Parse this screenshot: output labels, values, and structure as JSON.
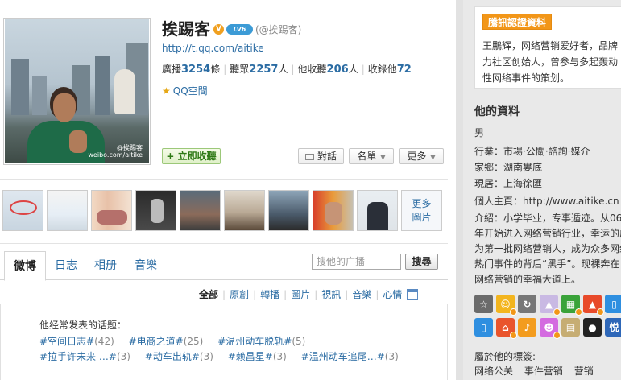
{
  "profile": {
    "name": "挨踢客",
    "vip_label": "LV6",
    "handle": "(@挨踢客)",
    "url": "http://t.qq.com/aitike",
    "avatar_watermark_1": "@挨踢客",
    "avatar_watermark_2": "weibo.com/aitike",
    "qzone": "QQ空間"
  },
  "stats": {
    "broadcast_label": "廣播",
    "broadcast_value": "3254",
    "broadcast_unit": "條",
    "listeners_label": "聽眾",
    "listeners_value": "2257",
    "listeners_unit": "人",
    "listening_label": "他收聽",
    "listening_value": "206",
    "listening_unit": "人",
    "favorites_label": "收錄他",
    "favorites_value": "72"
  },
  "actions": {
    "follow": "+ 立即收聽",
    "chat": "對話",
    "list": "名單",
    "more": "更多"
  },
  "photos": {
    "more_line1": "更多",
    "more_line2": "圖片"
  },
  "tabs": [
    {
      "label": "微博"
    },
    {
      "label": "日志"
    },
    {
      "label": "相册"
    },
    {
      "label": "音樂"
    }
  ],
  "search": {
    "placeholder": "搜他的广播",
    "button": "搜尋"
  },
  "filters": [
    "全部",
    "原創",
    "轉播",
    "圖片",
    "視訊",
    "音樂",
    "心情"
  ],
  "topics": {
    "title": "他经常发表的话题：",
    "row1": [
      {
        "name": "#空间日志#",
        "count": "(42)"
      },
      {
        "name": "#电商之道#",
        "count": "(25)"
      },
      {
        "name": "#温州动车脱轨#",
        "count": "(5)"
      }
    ],
    "row2": [
      {
        "name": "#拉手许未来 …#",
        "count": "(3)"
      },
      {
        "name": "#动车出轨#",
        "count": "(3)"
      },
      {
        "name": "#赖昌星#",
        "count": "(3)"
      },
      {
        "name": "#温州动车追尾…#",
        "count": "(3)"
      }
    ]
  },
  "sidebar": {
    "auth_tag": "騰訊認證資料",
    "auth_text": "王鵬辉，网络营销爱好者，品牌力社区创始人，曾参与多起轰动性网络事件的策划。",
    "info_title": "他的資料",
    "sex": "男",
    "job": "行業：市場·公關·諮詢·媒介",
    "hometown": "家鄉：湖南婁底",
    "residence": "現居：上海徐匯",
    "homepage_label": "個人主頁：",
    "homepage_url": "http://www.aitike.cn",
    "intro": "介紹：小学毕业，专事遁迹。从06年开始进入网络营销行业，幸运的成为第一批网络营销人，成为众多网络热门事件的背后“黑手”。现裸奔在网络营销的幸福大道上。",
    "tags_title": "屬於他的標簽:",
    "tags": [
      "网络公关",
      "事件营销",
      "营销"
    ]
  },
  "colors": {
    "link": "#2b6ca3",
    "auth_tag_bg": "#f29618",
    "follow_green": "#2f7a16"
  }
}
